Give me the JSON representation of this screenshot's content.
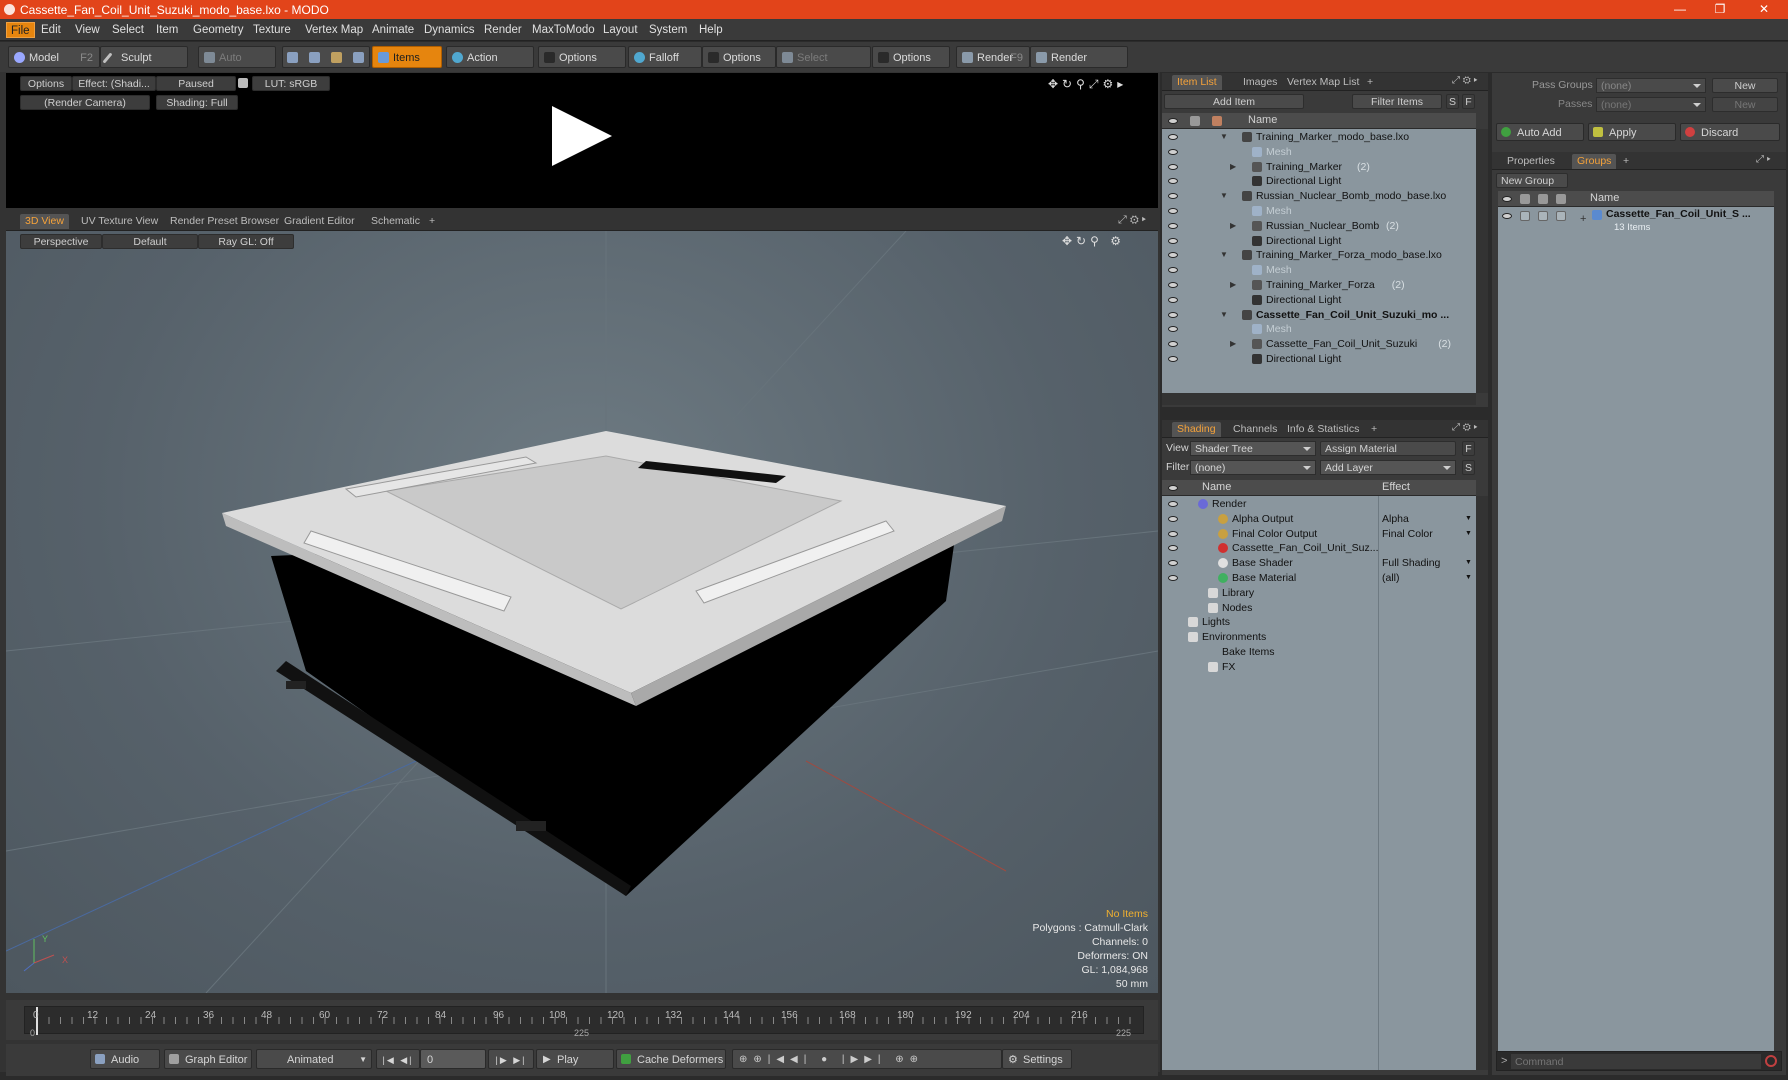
{
  "window": {
    "title": "Cassette_Fan_Coil_Unit_Suzuki_modo_base.lxo - MODO",
    "controls": [
      "—",
      "❐",
      "✕"
    ]
  },
  "menus": [
    "File",
    "Edit",
    "View",
    "Select",
    "Item",
    "Geometry",
    "Texture",
    "Vertex Map",
    "Animate",
    "Dynamics",
    "Render",
    "MaxToModo",
    "Layout",
    "System",
    "Help"
  ],
  "toolbar": {
    "model": "Model",
    "model_key": "F2",
    "sculpt": "Sculpt",
    "auto_select": "Auto Select",
    "items": "Items",
    "action_center": "Action Center",
    "options1": "Options",
    "falloff": "Falloff",
    "options2": "Options",
    "select_through": "Select Through",
    "options3": "Options",
    "render": "Render",
    "render_key": "F9",
    "render_window": "Render Window"
  },
  "preview": {
    "options": "Options",
    "effect": "Effect: (Shadi...",
    "paused": "Paused",
    "lut": "LUT: sRGB",
    "camera": "(Render Camera)",
    "shading": "Shading: Full"
  },
  "viewport": {
    "tabs": [
      "3D View",
      "UV Texture View",
      "Render Preset Browser",
      "Gradient Editor",
      "Schematic",
      "+"
    ],
    "perspective": "Perspective",
    "default": "Default",
    "raygl": "Ray GL: Off",
    "info": {
      "items": "No Items",
      "polygons": "Polygons : Catmull-Clark",
      "channels": "Channels: 0",
      "deformers": "Deformers: ON",
      "gl": "GL: 1,084,968",
      "focal": "50 mm"
    },
    "axis_y": "Y",
    "axis_x": "X"
  },
  "item_list": {
    "tabs": [
      "Item List",
      "Images",
      "Vertex Map List",
      "+"
    ],
    "add_item": "Add Item",
    "filter_items": "Filter Items",
    "s": "S",
    "f": "F",
    "col_name": "Name",
    "rows": [
      {
        "label": "Training_Marker_modo_base.lxo",
        "count": "",
        "kind": "scene",
        "bold": false
      },
      {
        "label": "Mesh",
        "count": "",
        "kind": "mesh",
        "bold": false
      },
      {
        "label": "Training_Marker",
        "count": "(2)",
        "kind": "group",
        "bold": false
      },
      {
        "label": "Directional Light",
        "count": "",
        "kind": "light",
        "bold": false
      },
      {
        "label": "Russian_Nuclear_Bomb_modo_base.lxo",
        "count": "",
        "kind": "scene",
        "bold": false
      },
      {
        "label": "Mesh",
        "count": "",
        "kind": "mesh",
        "bold": false
      },
      {
        "label": "Russian_Nuclear_Bomb",
        "count": "(2)",
        "kind": "group",
        "bold": false
      },
      {
        "label": "Directional Light",
        "count": "",
        "kind": "light",
        "bold": false
      },
      {
        "label": "Training_Marker_Forza_modo_base.lxo",
        "count": "",
        "kind": "scene",
        "bold": false
      },
      {
        "label": "Mesh",
        "count": "",
        "kind": "mesh",
        "bold": false
      },
      {
        "label": "Training_Marker_Forza",
        "count": "(2)",
        "kind": "group",
        "bold": false
      },
      {
        "label": "Directional Light",
        "count": "",
        "kind": "light",
        "bold": false
      },
      {
        "label": "Cassette_Fan_Coil_Unit_Suzuki_mo ...",
        "count": "",
        "kind": "scene",
        "bold": true
      },
      {
        "label": "Mesh",
        "count": "",
        "kind": "mesh",
        "bold": false
      },
      {
        "label": "Cassette_Fan_Coil_Unit_Suzuki",
        "count": "(2)",
        "kind": "group",
        "bold": false
      },
      {
        "label": "Directional Light",
        "count": "",
        "kind": "light",
        "bold": false
      }
    ]
  },
  "shading": {
    "tabs": [
      "Shading",
      "Channels",
      "Info & Statistics",
      "+"
    ],
    "view_label": "View",
    "view_value": "Shader Tree",
    "assign_material": "Assign Material",
    "f": "F",
    "filter_label": "Filter",
    "filter_value": "(none)",
    "add_layer": "Add Layer",
    "s": "S",
    "col_name": "Name",
    "col_effect": "Effect",
    "rows": [
      {
        "label": "Render",
        "effect": "",
        "color": "#6a6ad8"
      },
      {
        "label": "Alpha Output",
        "effect": "Alpha",
        "color": "#c8a040"
      },
      {
        "label": "Final Color Output",
        "effect": "Final Color",
        "color": "#c8a040"
      },
      {
        "label": "Cassette_Fan_Coil_Unit_Suz...",
        "effect": "",
        "color": "#d03030"
      },
      {
        "label": "Base Shader",
        "effect": "Full Shading",
        "color": "#e0e0e0"
      },
      {
        "label": "Base Material",
        "effect": "(all)",
        "color": "#40b060"
      },
      {
        "label": "Library",
        "effect": "",
        "color": ""
      },
      {
        "label": "Nodes",
        "effect": "",
        "color": ""
      },
      {
        "label": "Lights",
        "effect": "",
        "color": ""
      },
      {
        "label": "Environments",
        "effect": "",
        "color": ""
      },
      {
        "label": "Bake Items",
        "effect": "",
        "color": ""
      },
      {
        "label": "FX",
        "effect": "",
        "color": ""
      }
    ]
  },
  "groups_panel": {
    "pass_groups_label": "Pass Groups",
    "pass_groups_value": "(none)",
    "new1": "New",
    "passes_label": "Passes",
    "passes_value": "(none)",
    "new2": "New",
    "auto_add": "Auto Add",
    "apply": "Apply",
    "discard": "Discard",
    "tabs": [
      "Properties",
      "Groups",
      "+"
    ],
    "new_group": "New Group",
    "col_name": "Name",
    "group_name": "Cassette_Fan_Coil_Unit_S ...",
    "group_count": "13 Items"
  },
  "timeline": {
    "ticks": [
      "0",
      "12",
      "24",
      "36",
      "48",
      "60",
      "72",
      "84",
      "96",
      "108",
      "120",
      "132",
      "144",
      "156",
      "168",
      "180",
      "192",
      "204",
      "216"
    ],
    "left": "0",
    "mid": "225",
    "right": "225"
  },
  "bottom": {
    "audio": "Audio",
    "graph_editor": "Graph Editor",
    "animated": "Animated",
    "frame": "0",
    "play": "Play",
    "cache": "Cache Deformers",
    "settings": "Settings"
  },
  "command": {
    "placeholder": "Command"
  }
}
